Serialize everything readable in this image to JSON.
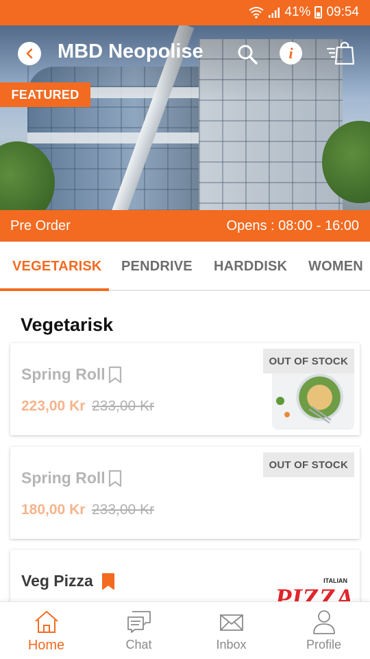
{
  "status_bar": {
    "battery": "41%",
    "time": "09:54"
  },
  "header": {
    "title": "MBD Neopolise",
    "featured_label": "FEATURED",
    "icons": [
      "back-icon",
      "search-icon",
      "info-icon",
      "cart-icon"
    ],
    "info_glyph": "i"
  },
  "info_strip": {
    "pre_order": "Pre Order",
    "opens": "Opens : 08:00 - 16:00"
  },
  "tabs": [
    {
      "label": "VEGETARISK",
      "active": true
    },
    {
      "label": "PENDRIVE"
    },
    {
      "label": "HARDDISK"
    },
    {
      "label": "WOMEN"
    }
  ],
  "section_title": "Vegetarisk",
  "products": [
    {
      "name": "Spring Roll",
      "price": "223,00 Kr",
      "old_price": "233,00 Kr",
      "badge": "OUT OF STOCK",
      "bookmarked": false,
      "image": "salad-bowl"
    },
    {
      "name": "Spring Roll",
      "price": "180,00 Kr",
      "old_price": "233,00 Kr",
      "badge": "OUT OF STOCK",
      "bookmarked": false
    },
    {
      "name": "Veg Pizza",
      "bookmarked": true,
      "image": "pizza-logo",
      "logo_small": "ITALIAN",
      "logo_text": "PIZZA"
    }
  ],
  "bottom_nav": [
    {
      "label": "Home",
      "icon": "home-icon",
      "active": true
    },
    {
      "label": "Chat",
      "icon": "chat-icon"
    },
    {
      "label": "Inbox",
      "icon": "inbox-icon"
    },
    {
      "label": "Profile",
      "icon": "profile-icon"
    }
  ],
  "colors": {
    "accent": "#f26b21",
    "muted_text": "#b5b5b5",
    "price": "#f5b48c"
  }
}
